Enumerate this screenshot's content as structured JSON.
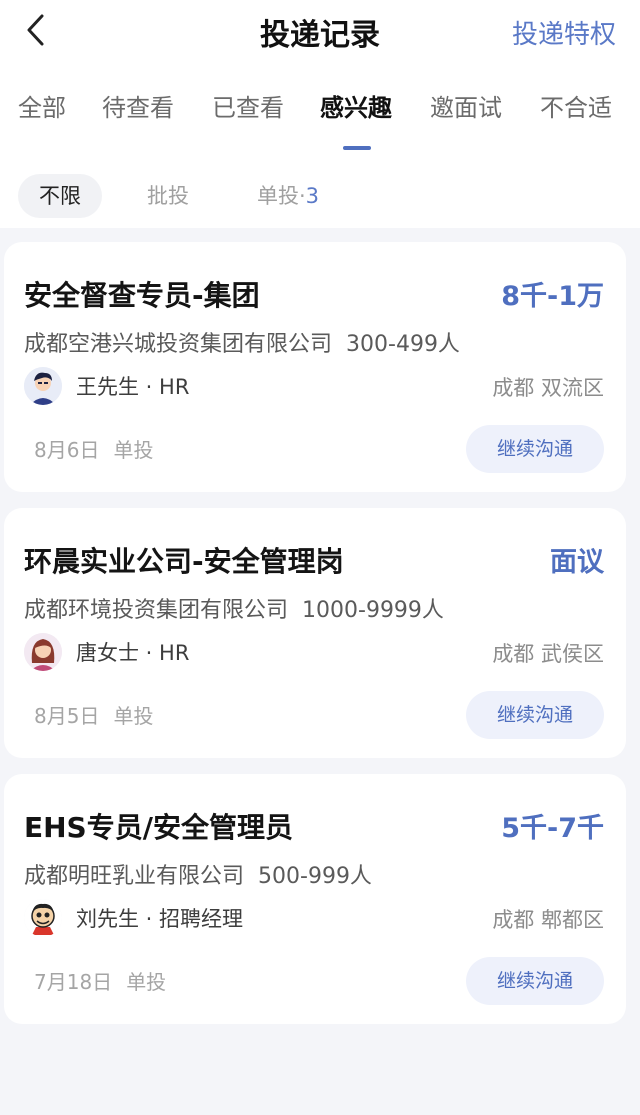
{
  "header": {
    "title": "投递记录",
    "right_link": "投递特权"
  },
  "tabs": [
    {
      "label": "全部"
    },
    {
      "label": "待查看"
    },
    {
      "label": "已查看"
    },
    {
      "label": "感兴趣",
      "active": true
    },
    {
      "label": "邀面试"
    },
    {
      "label": "不合适"
    }
  ],
  "filters": {
    "all": "不限",
    "batch": "批投",
    "single": "单投·",
    "single_count": "3"
  },
  "jobs": [
    {
      "title": "安全督查专员-集团",
      "salary": "8千-1万",
      "company": "成都空港兴城投资集团有限公司",
      "size": "300-499人",
      "recruiter": "王先生 · HR",
      "location": "成都 双流区",
      "date": "8月6日",
      "type": "单投",
      "button": "继续沟通"
    },
    {
      "title": "环晨实业公司-安全管理岗",
      "salary": "面议",
      "company": "成都环境投资集团有限公司",
      "size": "1000-9999人",
      "recruiter": "唐女士 · HR",
      "location": "成都 武侯区",
      "date": "8月5日",
      "type": "单投",
      "button": "继续沟通"
    },
    {
      "title": "EHS专员/安全管理员",
      "salary": "5千-7千",
      "company": "成都明旺乳业有限公司",
      "size": "500-999人",
      "recruiter": "刘先生 · 招聘经理",
      "location": "成都 郫都区",
      "date": "7月18日",
      "type": "单投",
      "button": "继续沟通"
    }
  ],
  "colors": {
    "accent": "#4f6fbf",
    "background": "#f4f5f9",
    "button_bg": "#eef1fb"
  }
}
